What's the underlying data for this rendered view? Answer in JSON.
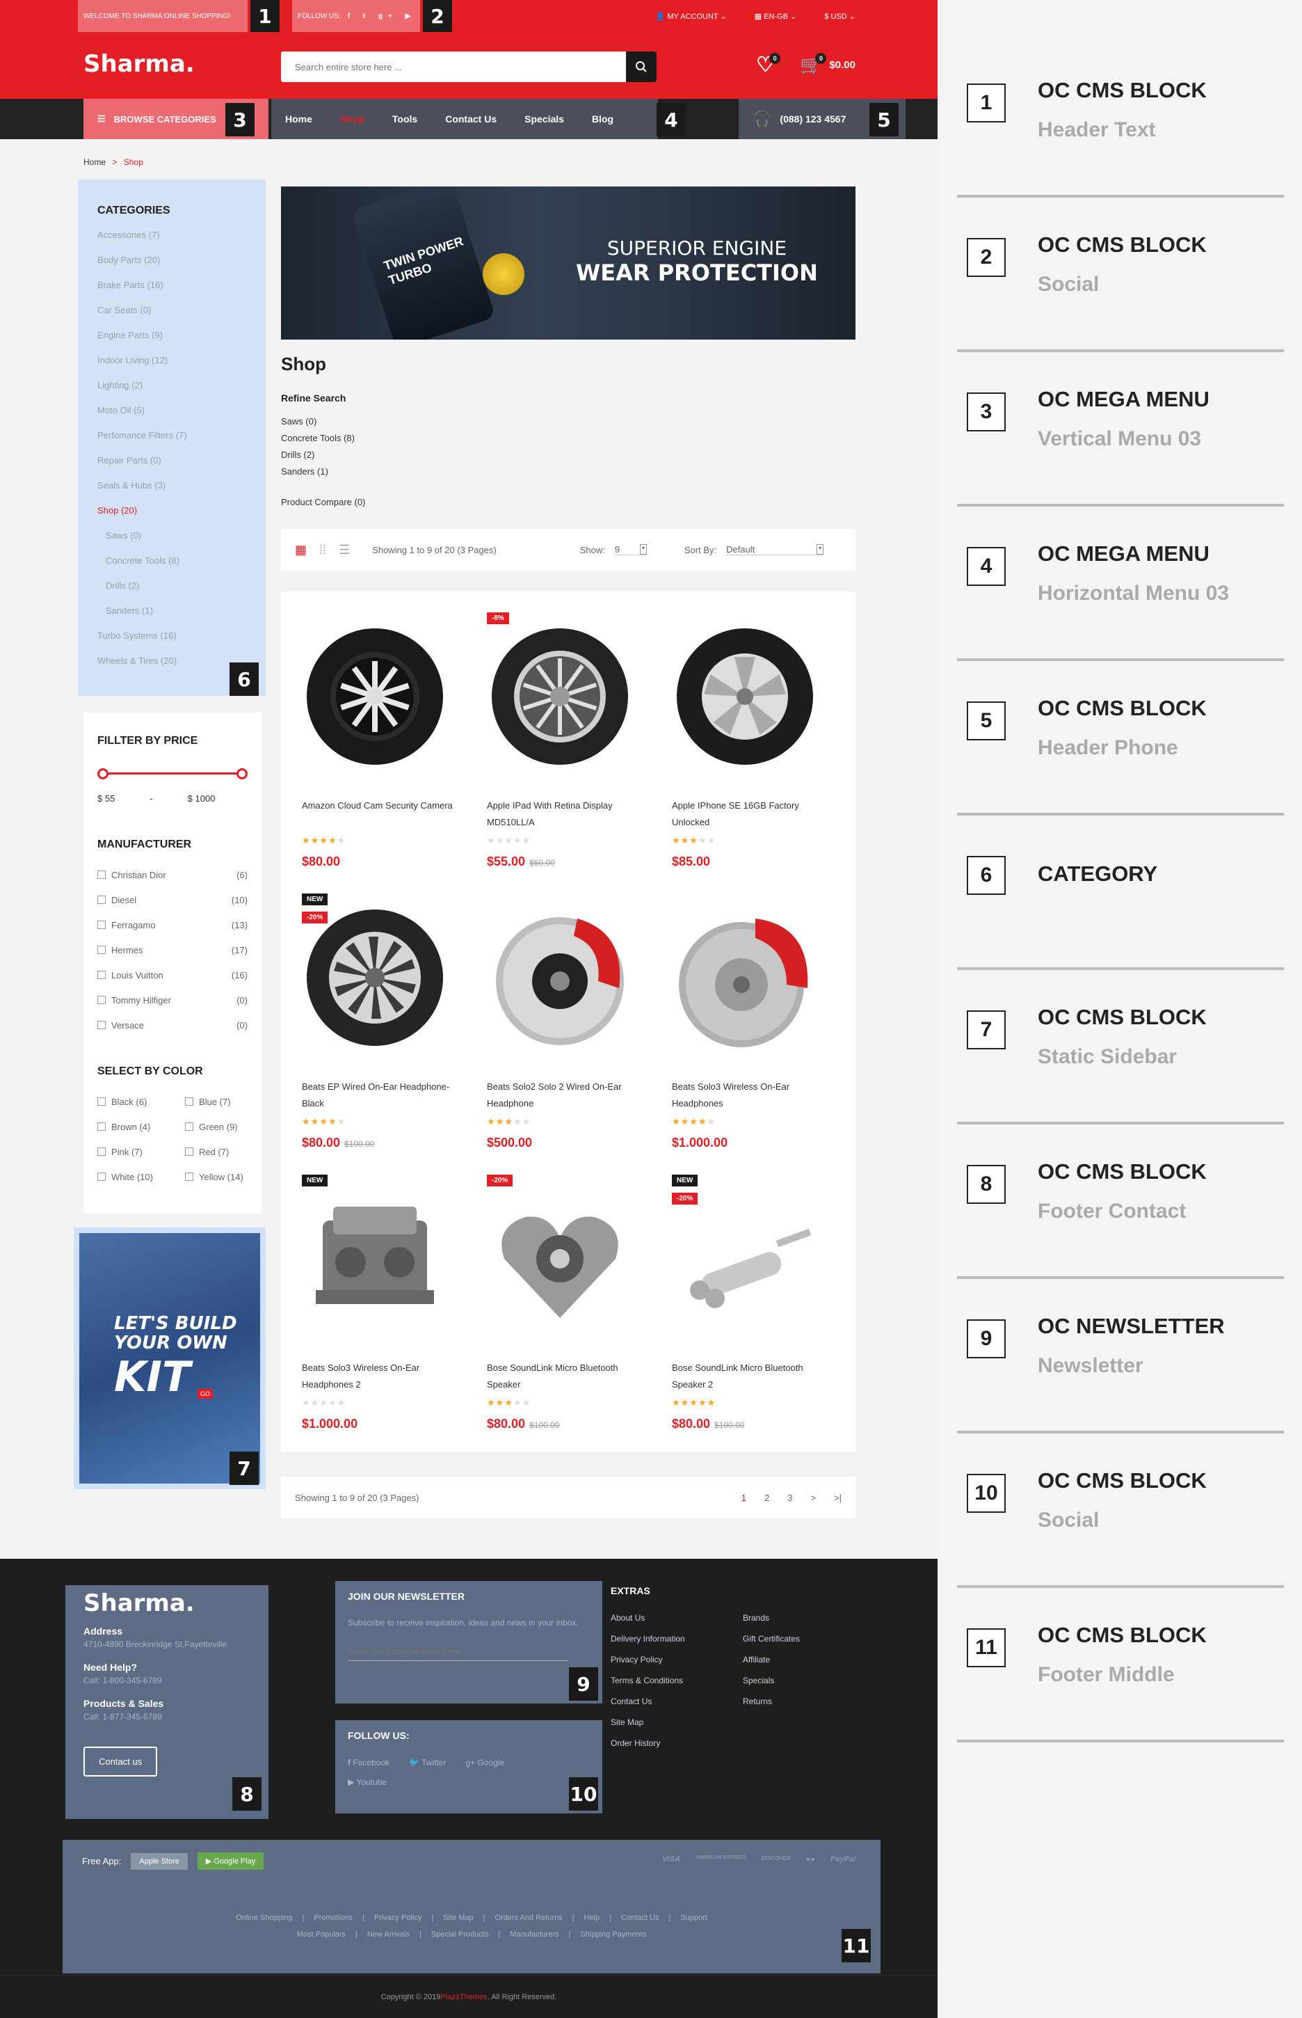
{
  "topbar": {
    "welcome": "WELCOME TO SHARMA ONLINE SHOPPING!",
    "follow": "FOLLOW US:",
    "account": "MY ACCOUNT",
    "language": "EN-GB",
    "currency": "$ USD"
  },
  "header": {
    "logo": "Sharma.",
    "search_placeholder": "Search entire store here ...",
    "wishlist_count": "0",
    "cart_count": "0",
    "cart_total": "$0.00"
  },
  "nav": {
    "browse": "BROWSE CATEGORIES",
    "items": [
      "Home",
      "Shop",
      "Tools",
      "Contact Us",
      "Specials",
      "Blog"
    ],
    "phone": "(088) 123 4567"
  },
  "breadcrumb": {
    "home": "Home",
    "current": "Shop"
  },
  "categories": {
    "title": "CATEGORIES",
    "items": [
      "Accessories (7)",
      "Body Parts (20)",
      "Brake Parts (16)",
      "Car Seats (0)",
      "Engine Parts (9)",
      "Indoor Living (12)",
      "Lighting (2)",
      "Moto Oil (5)",
      "Perfomance Filters (7)",
      "Repair Parts (0)",
      "Seals & Hubs (3)",
      "Shop (20)",
      "Saws (0)",
      "Concrete Tools (8)",
      "Drills (2)",
      "Sanders (1)",
      "Turbo Systems (16)",
      "Wheels & Tires (20)"
    ]
  },
  "price": {
    "title": "FILLTER BY PRICE",
    "min": "$ 55",
    "sep": "-",
    "max": "$ 1000"
  },
  "manufacturer": {
    "title": "MANUFACTURER",
    "items": [
      [
        "Christian Dior",
        "(6)"
      ],
      [
        "Diesel",
        "(10)"
      ],
      [
        "Ferragamo",
        "(13)"
      ],
      [
        "Hermes",
        "(17)"
      ],
      [
        "Louis Vuitton",
        "(16)"
      ],
      [
        "Tommy Hilfiger",
        "(0)"
      ],
      [
        "Versace",
        "(0)"
      ]
    ]
  },
  "colors": {
    "title": "SELECT BY COLOR",
    "items": [
      "Black (6)",
      "Blue (7)",
      "Brown (4)",
      "Green (9)",
      "Pink (7)",
      "Red (7)",
      "White (10)",
      "Yellow (14)"
    ]
  },
  "promo": {
    "line1": "LET'S BUILD",
    "line2": "YOUR OWN",
    "line3": "KIT",
    "go": "GO"
  },
  "banner": {
    "line1": "SUPERIOR ENGINE",
    "line2": "WEAR PROTECTION",
    "can": "TWIN POWER TURBO"
  },
  "shop": {
    "title": "Shop",
    "refine": "Refine Search",
    "refine_items": [
      "Saws (0)",
      "Concrete Tools (8)",
      "Drills (2)",
      "Sanders (1)"
    ],
    "compare": "Product Compare (0)",
    "showing": "Showing 1 to 9 of 20 (3 Pages)",
    "show_label": "Show:",
    "show_value": "9",
    "sort_label": "Sort By:",
    "sort_value": "Default"
  },
  "products": [
    {
      "name": "Amazon Cloud Cam Security Camera",
      "price": "$80.00",
      "old": "",
      "rating": 4,
      "tags": []
    },
    {
      "name": "Apple IPad With Retina Display MD510LL/A",
      "price": "$55.00",
      "old": "$60.00",
      "rating": 0,
      "tags": [
        "-8%"
      ]
    },
    {
      "name": "Apple IPhone SE 16GB Factory Unlocked",
      "price": "$85.00",
      "old": "",
      "rating": 3,
      "tags": []
    },
    {
      "name": "Beats EP Wired On-Ear Headphone-Black",
      "price": "$80.00",
      "old": "$100.00",
      "rating": 4,
      "tags": [
        "NEW",
        "-20%"
      ]
    },
    {
      "name": "Beats Solo2 Solo 2 Wired On-Ear Headphone",
      "price": "$500.00",
      "old": "",
      "rating": 3,
      "tags": []
    },
    {
      "name": "Beats Solo3 Wireless On-Ear Headphones",
      "price": "$1.000.00",
      "old": "",
      "rating": 4,
      "tags": []
    },
    {
      "name": "Beats Solo3 Wireless On-Ear Headphones 2",
      "price": "$1.000.00",
      "old": "",
      "rating": 0,
      "tags": [
        "NEW"
      ]
    },
    {
      "name": "Bose SoundLink Micro Bluetooth Speaker",
      "price": "$80.00",
      "old": "$100.00",
      "rating": 3,
      "tags": [
        "-20%"
      ]
    },
    {
      "name": "Bose SoundLink Micro Bluetooth Speaker 2",
      "price": "$80.00",
      "old": "$100.00",
      "rating": 5,
      "tags": [
        "NEW",
        "-20%"
      ]
    }
  ],
  "pagination": {
    "showing": "Showing 1 to 9 of 20 (3 Pages)",
    "pages": [
      "1",
      "2",
      "3",
      ">",
      ">|"
    ]
  },
  "footer": {
    "logo": "Sharma.",
    "address_label": "Address",
    "address": "4710-4890 Breckinridge St,Fayetteville",
    "help_label": "Need Help?",
    "help": "Call: 1-800-345-6789",
    "sales_label": "Products & Sales",
    "sales": "Call: 1-877-345-6789",
    "contact_button": "Contact us",
    "newsletter_title": "JOIN OUR NEWSLETTER",
    "newsletter_text": "Subscribe to receive inspiration, ideas and news in your inbox.",
    "newsletter_placeholder": "Enter You Email Address Here...",
    "follow_title": "FOLLOW US:",
    "social": [
      "Facebook",
      "Twitter",
      "Google",
      "Youtube"
    ],
    "extras_title": "EXTRAS",
    "extras_col1": [
      "About Us",
      "Delivery Information",
      "Privacy Policy",
      "Terms & Conditions",
      "Contact Us",
      "Site Map",
      "Order History"
    ],
    "extras_col2": [
      "Brands",
      "Gift Certificates",
      "Affiliate",
      "Specials",
      "Returns"
    ],
    "free_app": "Free App:",
    "apple": "Apple Store",
    "google": "Google Play",
    "payments": [
      "VISA",
      "AMERICAN EXPRESS",
      "DISCOVER",
      "",
      "PayPal"
    ],
    "links1": [
      "Online Shopping",
      "Promotions",
      "Privacy Policy",
      "Site Map",
      "Orders And Returns",
      "Help",
      "Contact Us",
      "Support"
    ],
    "links2": [
      "Most Populars",
      "New Arrivals",
      "Special Products",
      "Manufacturers",
      "Shipping Payments"
    ],
    "copyright_pre": "Copyright © 2019 ",
    "copyright_brand": "PlazaThemes",
    "copyright_post": ". All Right Reserved."
  },
  "badges": [
    "1",
    "2",
    "3",
    "4",
    "5",
    "6",
    "7",
    "8",
    "9",
    "10",
    "11"
  ],
  "legend": [
    {
      "num": "1",
      "title": "OC CMS BLOCK",
      "sub": "Header Text"
    },
    {
      "num": "2",
      "title": "OC CMS BLOCK",
      "sub": "Social"
    },
    {
      "num": "3",
      "title": "OC MEGA MENU",
      "sub": "Vertical Menu 03"
    },
    {
      "num": "4",
      "title": "OC MEGA MENU",
      "sub": "Horizontal Menu 03"
    },
    {
      "num": "5",
      "title": "OC CMS BLOCK",
      "sub": "Header Phone"
    },
    {
      "num": "6",
      "title": "CATEGORY",
      "sub": ""
    },
    {
      "num": "7",
      "title": "OC CMS BLOCK",
      "sub": "Static Sidebar"
    },
    {
      "num": "8",
      "title": "OC CMS BLOCK",
      "sub": "Footer Contact"
    },
    {
      "num": "9",
      "title": "OC NEWSLETTER",
      "sub": "Newsletter"
    },
    {
      "num": "10",
      "title": "OC CMS BLOCK",
      "sub": "Social"
    },
    {
      "num": "11",
      "title": "OC CMS BLOCK",
      "sub": "Footer Middle"
    }
  ],
  "colors_theme": {
    "primary": "#e31e24",
    "dark": "#222222",
    "slate": "#4a4f59",
    "footer_box": "#5e6b85"
  }
}
